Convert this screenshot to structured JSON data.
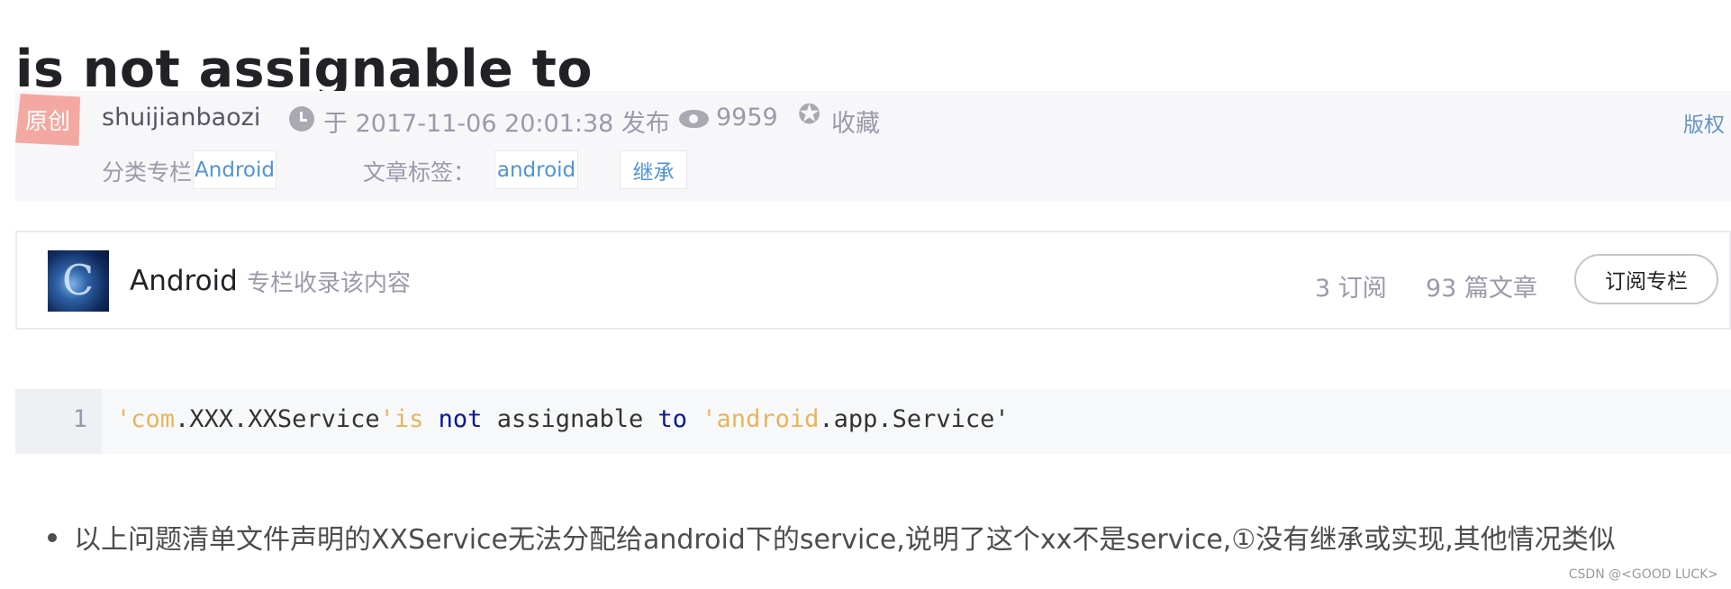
{
  "article": {
    "title": "is not assignable to"
  },
  "meta": {
    "badge": "原创",
    "author": "shuijianbaozi",
    "date": "于 2017-11-06 20:01:38 发布",
    "views": "9959",
    "favorite_label": "收藏",
    "copyright_label": "版权",
    "category_label": "分类专栏：",
    "categories": [
      "Android"
    ],
    "tag_label": "文章标签：",
    "tags": [
      "android",
      "继承"
    ],
    "icons": {
      "clock": "clock-icon",
      "eye": "eye-icon",
      "star": "star-icon"
    }
  },
  "column": {
    "name": "Android",
    "description": "专栏收录该内容",
    "subscribers": "3 订阅",
    "articles": "93 篇文章",
    "subscribe_button": "订阅专栏"
  },
  "code": {
    "line_number": "1",
    "tokens": [
      "'com",
      ".XXX.XXService",
      "'is",
      " ",
      "not",
      " assignable ",
      "to",
      " ",
      "'android",
      ".app.Service'"
    ]
  },
  "body": {
    "bullet_text": "以上问题清单文件声明的XXService无法分配给android下的service,说明了这个xx不是service,①没有继承或实现,其他情况类似"
  },
  "watermark": "CSDN @<GOOD LUCK>",
  "colors": {
    "badge": "#f3a9a1",
    "tag_text": "#5094d5",
    "code_string": "#e7b45b",
    "code_keyword": "#0b1694",
    "meta_background": "#f7f7f9"
  }
}
